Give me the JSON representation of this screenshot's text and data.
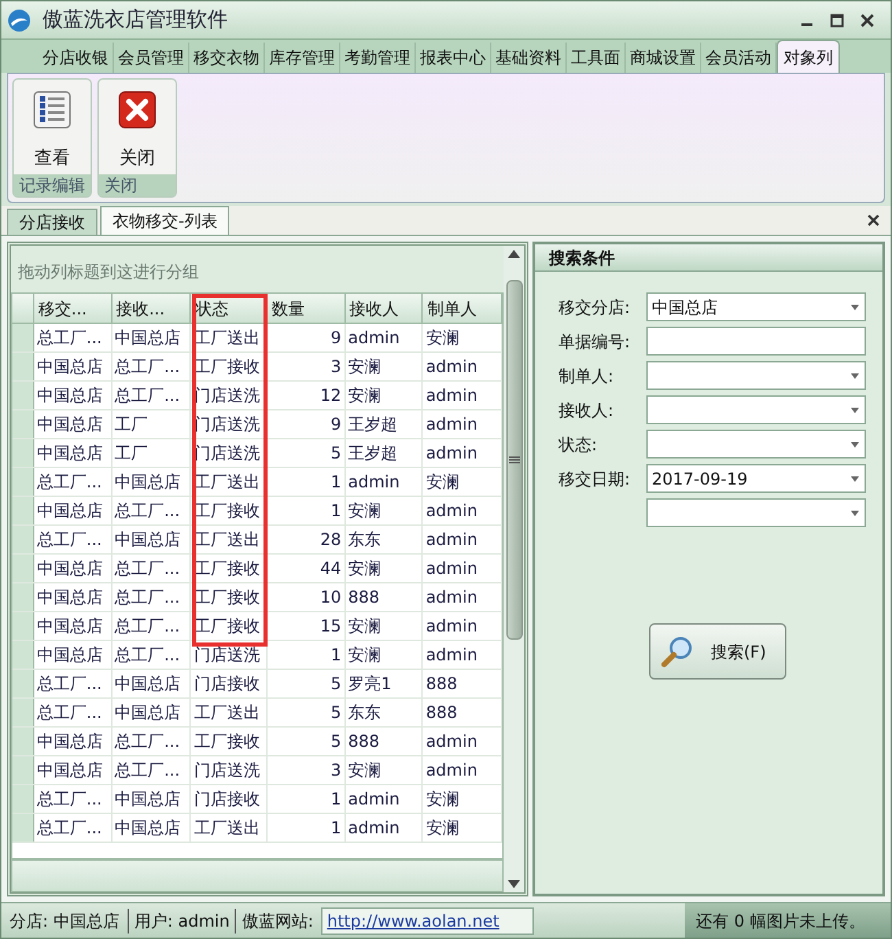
{
  "window": {
    "title": "傲蓝洗衣店管理软件"
  },
  "menu_tabs": [
    {
      "label": "分店收银",
      "selected": false
    },
    {
      "label": "会员管理",
      "selected": false
    },
    {
      "label": "移交衣物",
      "selected": false
    },
    {
      "label": "库存管理",
      "selected": false
    },
    {
      "label": "考勤管理",
      "selected": false
    },
    {
      "label": "报表中心",
      "selected": false
    },
    {
      "label": "基础资料",
      "selected": false
    },
    {
      "label": "工具面",
      "selected": false
    },
    {
      "label": "商城设置",
      "selected": false
    },
    {
      "label": "会员活动",
      "selected": false
    },
    {
      "label": "对象列",
      "selected": true
    }
  ],
  "ribbon_groups": [
    {
      "label": "记录编辑",
      "buttons": [
        {
          "label": "查看",
          "kind": "list"
        }
      ]
    },
    {
      "label": "关闭",
      "buttons": [
        {
          "label": "关闭",
          "kind": "close"
        }
      ]
    }
  ],
  "doc_tabs": [
    {
      "label": "分店接收",
      "selected": false
    },
    {
      "label": "衣物移交-列表",
      "selected": true
    }
  ],
  "group_hint": "拖动列标题到这进行分组",
  "table": {
    "columns": [
      {
        "label": "移交...",
        "highlighted": false
      },
      {
        "label": "接收...",
        "highlighted": false
      },
      {
        "label": "状态",
        "highlighted": true
      },
      {
        "label": "数量",
        "highlighted": false
      },
      {
        "label": "接收人",
        "highlighted": false
      },
      {
        "label": "制单人",
        "highlighted": false
      }
    ],
    "rows": [
      [
        "总工厂...",
        "中国总店",
        "工厂送出",
        "9",
        "admin",
        "安澜"
      ],
      [
        "中国总店",
        "总工厂...",
        "工厂接收",
        "3",
        "安澜",
        "admin"
      ],
      [
        "中国总店",
        "总工厂...",
        "门店送洗",
        "12",
        "安澜",
        "admin"
      ],
      [
        "中国总店",
        "工厂",
        "门店送洗",
        "9",
        "王岁超",
        "admin"
      ],
      [
        "中国总店",
        "工厂",
        "门店送洗",
        "5",
        "王岁超",
        "admin"
      ],
      [
        "总工厂...",
        "中国总店",
        "工厂送出",
        "1",
        "admin",
        "安澜"
      ],
      [
        "中国总店",
        "总工厂...",
        "工厂接收",
        "1",
        "安澜",
        "admin"
      ],
      [
        "总工厂...",
        "中国总店",
        "工厂送出",
        "28",
        "东东",
        "admin"
      ],
      [
        "中国总店",
        "总工厂...",
        "工厂接收",
        "44",
        "安澜",
        "admin"
      ],
      [
        "中国总店",
        "总工厂...",
        "工厂接收",
        "10",
        "888",
        "admin"
      ],
      [
        "中国总店",
        "总工厂...",
        "工厂接收",
        "15",
        "安澜",
        "admin"
      ],
      [
        "中国总店",
        "总工厂...",
        "门店送洗",
        "1",
        "安澜",
        "admin"
      ],
      [
        "总工厂...",
        "中国总店",
        "门店接收",
        "5",
        "罗亮1",
        "888"
      ],
      [
        "总工厂...",
        "中国总店",
        "工厂送出",
        "5",
        "东东",
        "888"
      ],
      [
        "中国总店",
        "总工厂...",
        "工厂接收",
        "5",
        "888",
        "admin"
      ],
      [
        "中国总店",
        "总工厂...",
        "门店送洗",
        "3",
        "安澜",
        "admin"
      ],
      [
        "总工厂...",
        "中国总店",
        "门店接收",
        "1",
        "admin",
        "安澜"
      ],
      [
        "总工厂...",
        "中国总店",
        "工厂送出",
        "1",
        "admin",
        "安澜"
      ]
    ]
  },
  "search_panel": {
    "title": "搜索条件",
    "fields": [
      {
        "label": "移交分店:",
        "value": "中国总店",
        "kind": "dropdown"
      },
      {
        "label": "单据编号:",
        "kind": "text"
      },
      {
        "label": "制单人:",
        "kind": "dropdown"
      },
      {
        "label": "接收人:",
        "kind": "dropdown"
      },
      {
        "label": "状态:",
        "kind": "dropdown"
      },
      {
        "label": "移交日期:",
        "value": "2017-09-19",
        "kind": "dropdown"
      },
      {
        "kind": "dropdown"
      }
    ],
    "button": "搜索(F)"
  },
  "status_bar": {
    "branch": "分店: 中国总店",
    "user": "用户: admin",
    "site_label": "傲蓝网站:",
    "site_link": "http://www.aolan.net",
    "upload": "还有 0 幅图片未上传。"
  }
}
